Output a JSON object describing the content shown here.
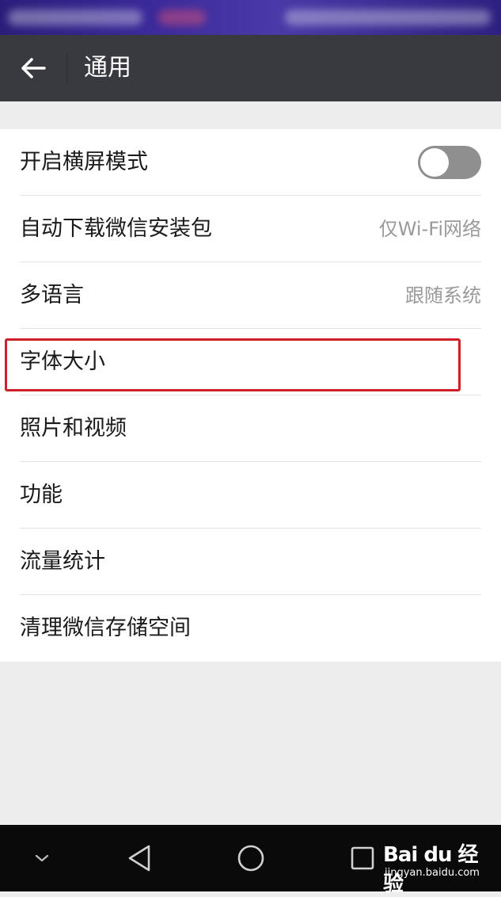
{
  "app_bar": {
    "title": "通用",
    "back_icon": "arrow-left-icon"
  },
  "settings": [
    {
      "label": "开启横屏模式",
      "control": "toggle",
      "toggle_on": false
    },
    {
      "label": "自动下载微信安装包",
      "value": "仅Wi-Fi网络"
    },
    {
      "label": "多语言",
      "value": "跟随系统"
    },
    {
      "label": "字体大小",
      "highlighted": true
    },
    {
      "label": "照片和视频"
    },
    {
      "label": "功能"
    },
    {
      "label": "流量统计"
    },
    {
      "label": "清理微信存储空间"
    }
  ],
  "highlight_color": "#cc2128",
  "nav_bar": {
    "icons": [
      "chevron-down-icon",
      "back-triangle-icon",
      "home-circle-icon",
      "recents-square-icon"
    ]
  },
  "watermark": {
    "logo": "Bai du 经验",
    "url": "jingyan.baidu.com"
  }
}
